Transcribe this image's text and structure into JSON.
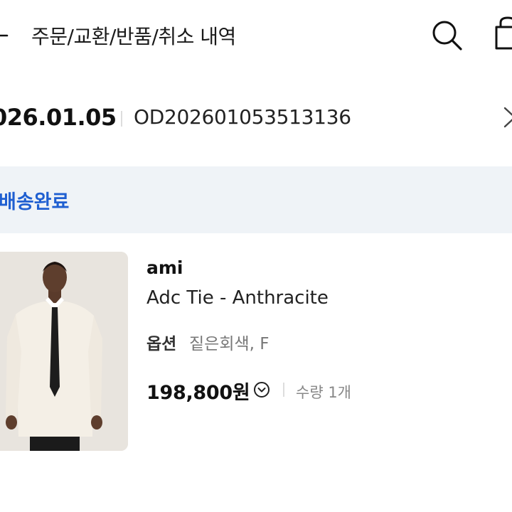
{
  "header": {
    "title": "주문/교환/반품/취소 내역",
    "back_icon": "arrow-left-icon",
    "search_icon": "search-icon",
    "bag_icon": "shopping-bag-icon"
  },
  "order": {
    "date": "026.01.05",
    "number": "OD202601053513136",
    "chevron_icon": "chevron-right-icon"
  },
  "status": {
    "label": "배송완료",
    "color": "#1f5fd1",
    "background": "#eff3f7"
  },
  "product": {
    "brand": "ami",
    "name": "Adc Tie - Anthracite",
    "option_label": "옵션",
    "option_value": "짙은회색, F",
    "price": "198,800원",
    "quantity": "수량 1개"
  }
}
